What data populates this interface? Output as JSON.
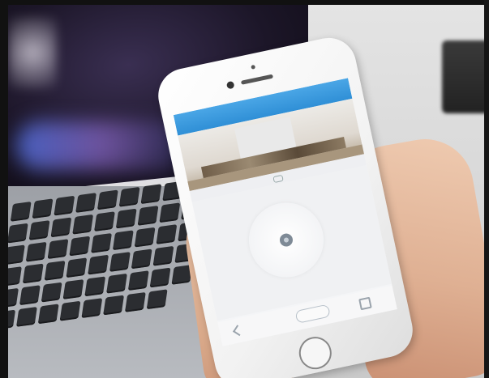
{
  "scene": {
    "description_free": true,
    "colors": {
      "app_header": "#2f8fd6",
      "laptop_glow": "#6e7be0",
      "skin": "#dfb093",
      "phone_body": "#f2f2f2"
    },
    "icons": {
      "control_center": "camera-dot-icon",
      "divider": "pill-icon",
      "toggle": "toggle-icon",
      "nav_back": "back-arrow-icon",
      "nav_home": "square-icon"
    }
  }
}
